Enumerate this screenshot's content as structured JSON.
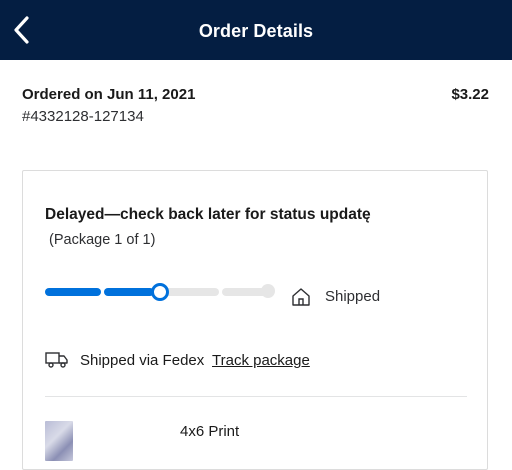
{
  "header": {
    "title": "Order Details",
    "back_icon": "chevron-left-icon",
    "background_color": "#041e42"
  },
  "order": {
    "date": "Ordered on Jun 11, 2021",
    "number": "#4332128-127134",
    "total": "$3.22"
  },
  "package": {
    "status_title": "Delayed—check back later for status updatę",
    "count": "(Package 1 of 1)",
    "progress_fraction": 0.5,
    "progress_color": "#0071dc",
    "stage_label": "Shipped",
    "stage_icon": "house-icon",
    "carrier_icon": "truck-icon",
    "carrier_text": "Shipped via Fedex",
    "track_link": "Track package"
  },
  "items": [
    {
      "name": "4x6 Print",
      "thumbnail": "photo-thumbnail"
    }
  ]
}
